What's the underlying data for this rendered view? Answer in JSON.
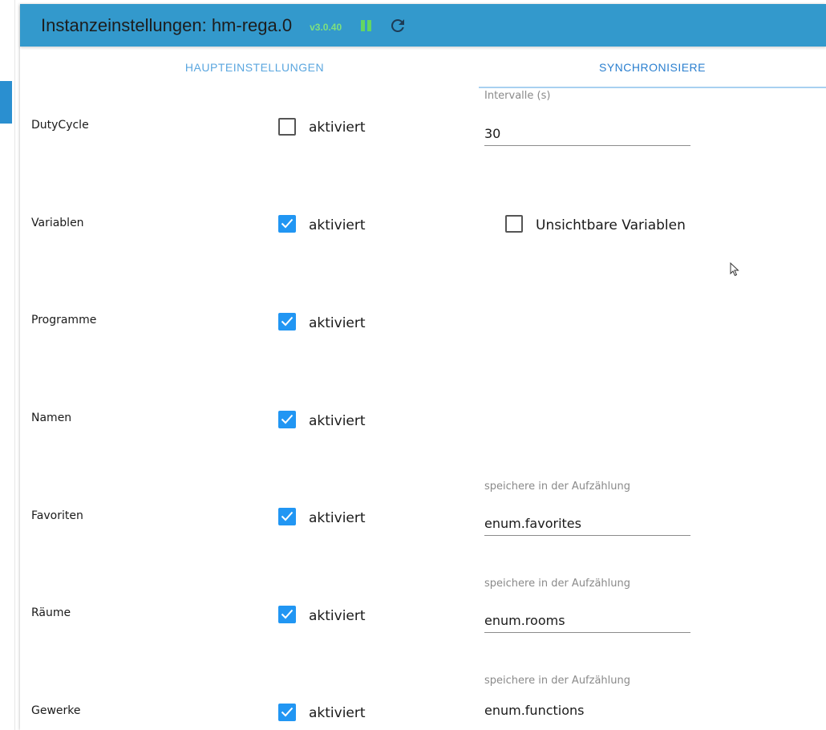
{
  "header": {
    "title": "Instanzeinstellungen: hm-rega.0",
    "version": "v3.0.40",
    "pause_icon": "pause-icon",
    "reload_icon": "reload-icon"
  },
  "tabs": [
    {
      "label": "HAUPTEINSTELLUNGEN",
      "active": false
    },
    {
      "label": "SYNCHRONISIERE",
      "active": true
    }
  ],
  "checkbox_label": "aktiviert",
  "rows": [
    {
      "label": "DutyCycle",
      "checked": false,
      "field_label": "Intervalle (s)",
      "field_value": "30"
    },
    {
      "label": "Variablen",
      "checked": true,
      "extra_checkbox": {
        "label": "Unsichtbare Variablen",
        "checked": false
      }
    },
    {
      "label": "Programme",
      "checked": true
    },
    {
      "label": "Namen",
      "checked": true
    },
    {
      "label": "Favoriten",
      "checked": true,
      "field_label": "speichere in der Aufzählung",
      "field_value": "enum.favorites"
    },
    {
      "label": "Räume",
      "checked": true,
      "field_label": "speichere in der Aufzählung",
      "field_value": "enum.rooms"
    },
    {
      "label": "Gewerke",
      "checked": true,
      "field_label": "speichere in der Aufzählung",
      "field_value": "enum.functions"
    }
  ],
  "colors": {
    "header_bg": "#3399cc",
    "checkbox_checked": "#2196f3",
    "version_text": "#7ee07e",
    "tab_active": "#2a7fcf"
  }
}
